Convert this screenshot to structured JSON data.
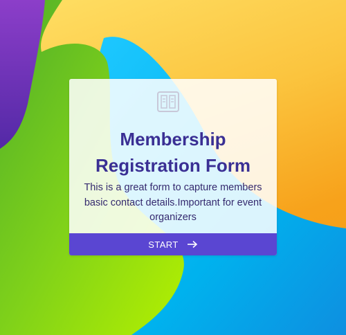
{
  "form": {
    "title": "Membership Registration Form",
    "description": "This is a great form to capture members basic contact details.Important for event organizers",
    "start_label": "START",
    "icon": "form-columns-icon",
    "start_icon": "arrow-right-icon"
  },
  "colors": {
    "title": "#3a2f94",
    "button": "#5a46d2",
    "bg_orange": "#f7a21b",
    "bg_yellow": "#ffe066",
    "bg_green": "#7ed321",
    "bg_blue": "#00b4f0",
    "bg_purple": "#6b2fb3"
  }
}
